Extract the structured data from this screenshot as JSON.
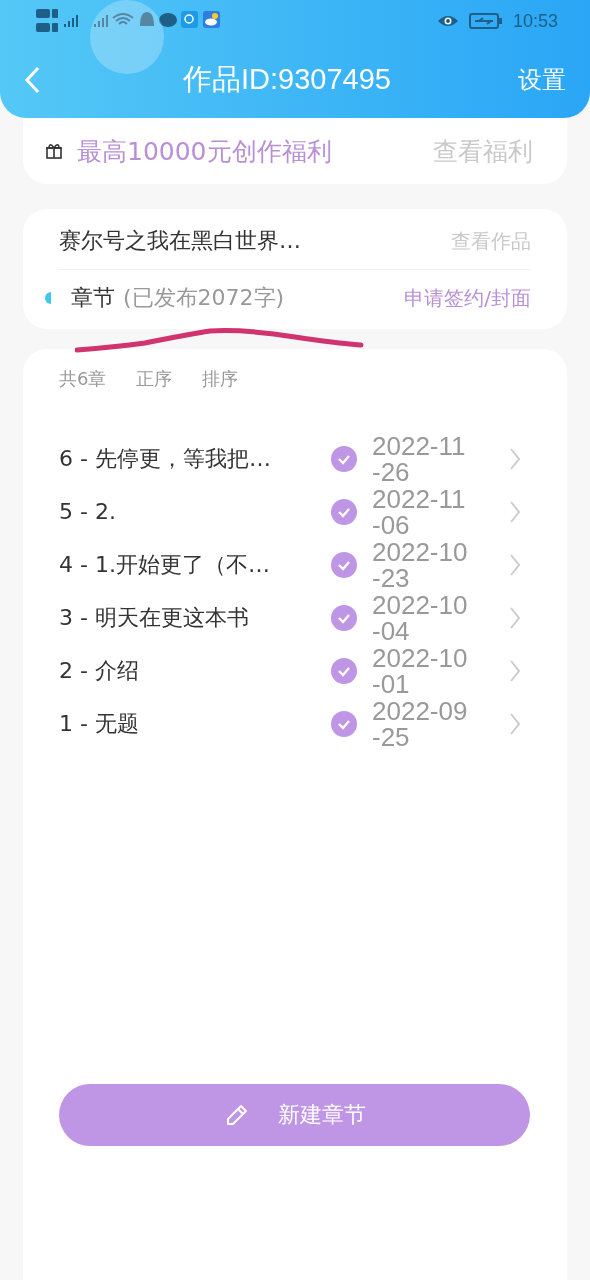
{
  "status_bar": {
    "time": "10:53"
  },
  "header": {
    "title": "作品ID:9307495",
    "action": "设置"
  },
  "benefit": {
    "text": "最高10000元创作福利",
    "link": "查看福利"
  },
  "work": {
    "title": "赛尔号之我在黑白世界…",
    "link": "查看作品",
    "section_label": "章节",
    "published": "(已发布2072字)",
    "sign_link": "申请签约/封面"
  },
  "chapters": {
    "count": "共6章",
    "sort_options": [
      "正序",
      "排序"
    ],
    "items": [
      {
        "title": "6 - 先停更，等我把…",
        "published": true,
        "date": "2022-11-26"
      },
      {
        "title": "5 - 2.",
        "published": true,
        "date": "2022-11-06"
      },
      {
        "title": "4 - 1.开始更了（不…",
        "published": true,
        "date": "2022-10-23"
      },
      {
        "title": "3 - 明天在更这本书",
        "published": true,
        "date": "2022-10-04"
      },
      {
        "title": "2 - 介绍",
        "published": true,
        "date": "2022-10-01"
      },
      {
        "title": "1 - 无题",
        "published": true,
        "date": "2022-09-25"
      }
    ]
  },
  "new_chapter_button": "新建章节"
}
